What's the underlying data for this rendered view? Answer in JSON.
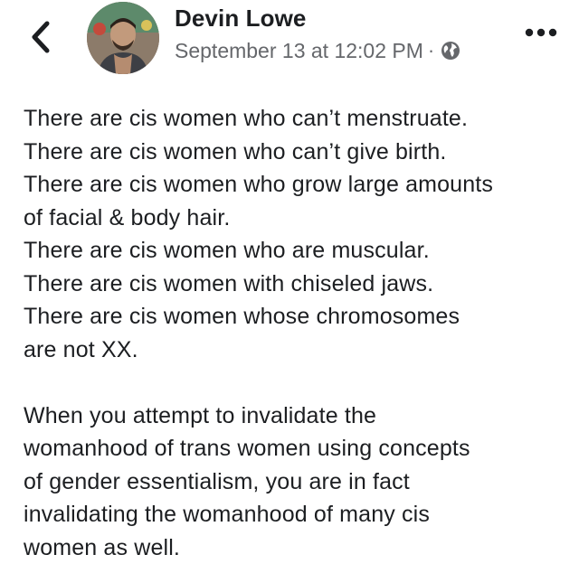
{
  "header": {
    "author_name": "Devin Lowe",
    "timestamp": "September 13 at 12:02 PM",
    "separator": "·",
    "privacy_icon": "globe-icon",
    "back_icon": "chevron-left-icon",
    "more_icon": "more-horizontal-icon"
  },
  "post": {
    "paragraph1": [
      "There are cis women who can’t menstruate.",
      "There are cis women who can’t give birth.",
      "There are cis women who grow large amounts",
      "of facial & body hair.",
      "There are cis women who are muscular.",
      "There are cis women with chiseled jaws.",
      "There are cis women whose chromosomes",
      "are not XX."
    ],
    "paragraph2": [
      "When you attempt to invalidate the",
      "womanhood of trans women using concepts",
      "of gender essentialism, you are in fact",
      "invalidating the womanhood of many cis",
      "women as well."
    ]
  },
  "colors": {
    "text_primary": "#1c1e21",
    "text_secondary": "#65676b",
    "background": "#ffffff"
  }
}
